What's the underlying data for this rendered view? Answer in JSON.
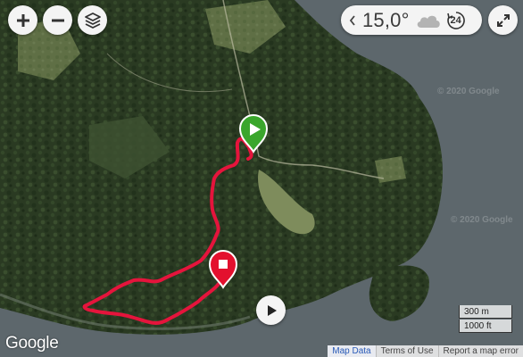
{
  "controls": {
    "zoom_in_icon": "plus-icon",
    "zoom_out_icon": "minus-icon",
    "layers_icon": "layers-icon",
    "fullscreen_icon": "expand-icon"
  },
  "weather": {
    "temperature": "15,0°",
    "icon": "cloud-icon",
    "hours": "24"
  },
  "watermarks": [
    "© 2020 Google",
    "© 2020 Google"
  ],
  "markers": {
    "start": {
      "icon": "play-icon",
      "color": "#3aa62c"
    },
    "end": {
      "icon": "stop-icon",
      "color": "#e3102e"
    }
  },
  "track": {
    "color": "#e5143c"
  },
  "scale": {
    "metric": "300 m",
    "imperial": "1000 ft"
  },
  "google_logo": "Google",
  "attribution": {
    "map_data": "Map Data",
    "terms": "Terms of Use",
    "report": "Report a map error"
  }
}
